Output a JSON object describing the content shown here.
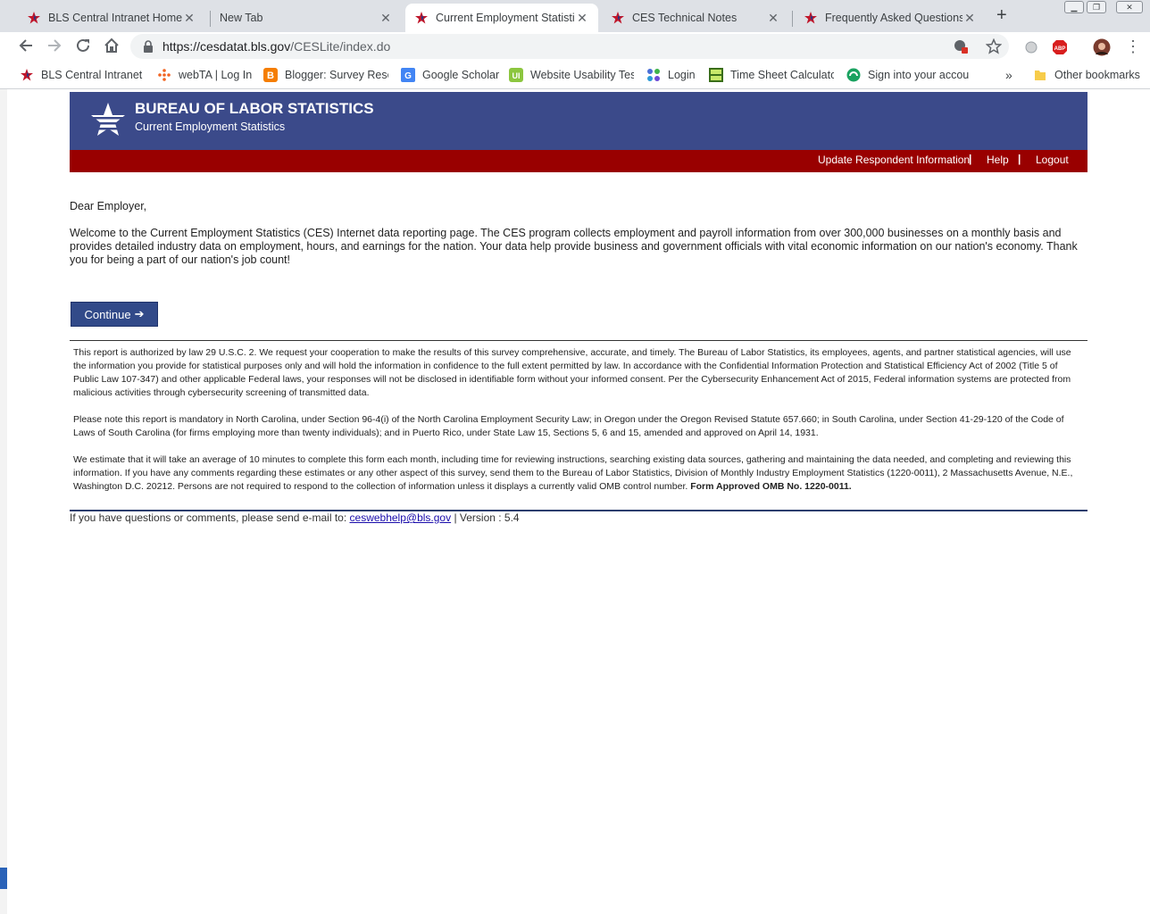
{
  "browser": {
    "tabs": [
      {
        "title": "BLS Central Intranet Home Pa",
        "favicon": "bls-star-icon",
        "active": false
      },
      {
        "title": "New Tab",
        "favicon": "",
        "active": false
      },
      {
        "title": "Current Employment Statistic",
        "favicon": "bls-star-icon",
        "active": true
      },
      {
        "title": "CES Technical Notes",
        "favicon": "bls-star-icon",
        "active": false
      },
      {
        "title": "Frequently Asked Questions",
        "favicon": "bls-star-icon",
        "active": false
      }
    ],
    "close_glyph": "✕",
    "new_tab_glyph": "+",
    "url_host": "https://cesdatat.bls.gov",
    "url_path": "/CESLite/index.do",
    "bookmarks": [
      {
        "label": "BLS Central Intranet H",
        "icon": "bls-star-icon"
      },
      {
        "label": "webTA | Log In",
        "icon": "webta-icon"
      },
      {
        "label": "Blogger: Survey Rese",
        "icon": "blogger-icon"
      },
      {
        "label": "Google Scholar",
        "icon": "google-scholar-icon"
      },
      {
        "label": "Website Usability Tes",
        "icon": "usability-icon"
      },
      {
        "label": "Login",
        "icon": "login-dots-icon"
      },
      {
        "label": "Time Sheet Calculato",
        "icon": "timecalc-icon"
      },
      {
        "label": "Sign into your accou",
        "icon": "sign-in-icon"
      }
    ],
    "bookmarks_overflow": "»",
    "other_bookmarks": "Other bookmarks"
  },
  "page": {
    "agency": "BUREAU OF LABOR STATISTICS",
    "program": "Current Employment Statistics",
    "nav": {
      "update": "Update Respondent Information",
      "help": "Help",
      "logout": "Logout",
      "separator": "|"
    },
    "greeting": "Dear Employer,",
    "welcome": "Welcome to the Current Employment Statistics (CES) Internet data reporting page. The CES program collects employment and payroll information from over 300,000 businesses on a monthly basis and provides detailed industry data on employment, hours, and earnings for the nation. Your data help provide business and government officials with vital economic information on our nation's economy. Thank you for being a part of our nation's job count!",
    "continue_label": "Continue",
    "continue_arrow": "➔",
    "legal": {
      "p1": "This report is authorized by law 29 U.S.C. 2. We request your cooperation to make the results of this survey comprehensive, accurate, and timely. The Bureau of Labor Statistics, its employees, agents, and partner statistical agencies, will use the information you provide for statistical purposes only and will hold the information in confidence to the full extent permitted by law. In accordance with the Confidential Information Protection and Statistical Efficiency Act of 2002 (Title 5 of Public Law 107-347) and other applicable Federal laws, your responses will not be disclosed in identifiable form without your informed consent. Per the Cybersecurity Enhancement Act of 2015, Federal information systems are protected from malicious activities through cybersecurity screening of transmitted data.",
      "p2": "Please note this report is mandatory in North Carolina, under Section 96-4(i) of the North Carolina Employment Security Law; in Oregon under the Oregon Revised Statute 657.660; in South Carolina, under Section 41-29-120 of the Code of Laws of South Carolina (for firms employing more than twenty individuals); and in Puerto Rico, under State Law 15, Sections 5, 6 and 15, amended and approved on April 14, 1931.",
      "p3": "We estimate that it will take an average of 10 minutes to complete this form each month, including time for reviewing instructions, searching existing data sources, gathering and maintaining the data needed, and completing and reviewing this information. If you have any comments regarding these estimates or any other aspect of this survey, send them to the Bureau of Labor Statistics, Division of Monthly Industry Employment Statistics (1220-0011), 2 Massachusetts Avenue, N.E., Washington D.C. 20212. Persons are not required to respond to the collection of information unless it displays a currently valid OMB control number.",
      "p3_bold": "Form Approved OMB No. 1220-0011."
    },
    "footer": {
      "prefix": "If you have questions or comments, please send e-mail to:",
      "email": "ceswebhelp@bls.gov",
      "suffix": "| Version : 5.4"
    }
  },
  "colors": {
    "header_blue": "#3b4a8a",
    "nav_red": "#990000",
    "button_blue": "#324a89"
  }
}
